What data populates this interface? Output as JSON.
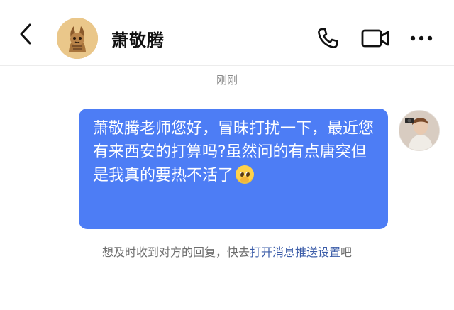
{
  "header": {
    "contact_name": "萧敬腾",
    "icons": [
      "back-arrow-icon",
      "contact-avatar",
      "phone-icon",
      "video-camera-icon",
      "more-dots-icon"
    ]
  },
  "chat": {
    "timestamp": "刚刚",
    "messages": [
      {
        "sender": "me",
        "text": "萧敬腾老师您好，冒昧打扰一下，最近您有来西安的打算吗?虽然问的有点唐突但是我真的要热不活了",
        "emoji": "pleading-face-emoji"
      }
    ]
  },
  "notice": {
    "prefix": "想及时收到对方的回复，快去",
    "link": "打开消息推送设置",
    "suffix": "吧"
  },
  "colors": {
    "bubble": "#4d7df5",
    "link": "#3b5ca8",
    "timestamp": "#8a8a8a"
  }
}
